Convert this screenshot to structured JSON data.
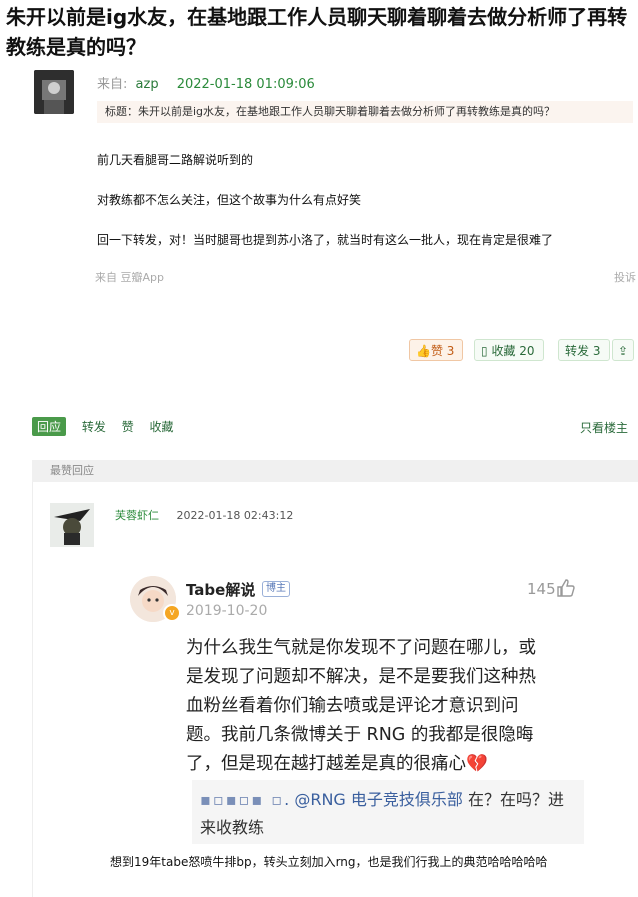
{
  "post": {
    "title": "朱开以前是ig水友，在基地跟工作人员聊天聊着聊着去做分析师了再转教练是真的吗？",
    "from_label": "来自:",
    "author": "azp",
    "time": "2022-01-18 01:09:06",
    "quote": "标题：朱开以前是ig水友，在基地跟工作人员聊天聊着聊着去做分析师了再转教练是真的吗？",
    "body": [
      "前几天看腿哥二路解说听到的",
      "对教练都不怎么关注，但这个故事为什么有点好笑",
      "回一下转发，对！当时腿哥也提到苏小洛了，就当时有这么一批人，现在肯定是很难了"
    ],
    "source": "来自 豆瓣App",
    "report": "投诉"
  },
  "actions": {
    "like": "赞 3",
    "favorite": "收藏 20",
    "share": "转发 3"
  },
  "bar": {
    "reply": "回应",
    "share": "转发",
    "like": "赞",
    "favorite": "收藏",
    "only_op": "只看楼主"
  },
  "hot": {
    "label": "最赞回应",
    "commenter": "芙蓉虾仁",
    "time": "2022-01-18 02:43:12",
    "weibo": {
      "name": "Tabe解说",
      "tag": "博主",
      "date": "2019-10-20",
      "likes": "145",
      "lines": [
        "为什么我生气就是你发现不了问题在哪儿，或",
        "是发现了问题却不解决，是不是要我们这种热",
        "血粉丝看着你们输去喷或是评论才意识到问",
        "题。我前几条微博关于 RNG 的我都是很隐晦",
        "了，但是现在越打越差是真的很痛心💔"
      ],
      "quote_dots": "▪▫▪▫▪ ▫",
      "quote_mention": ". @RNG 电子竞技俱乐部",
      "quote_rest": " 在？在吗？进",
      "quote_line2": "来收教练"
    },
    "caption": "想到19年tabe怒喷牛排bp，转头立刻加入rng，也是我们行我上的典范哈哈哈哈哈"
  },
  "colors": {
    "accent": "#2a8a3a",
    "like": "#c25c15",
    "quote_bg": "#fbf4ef"
  }
}
